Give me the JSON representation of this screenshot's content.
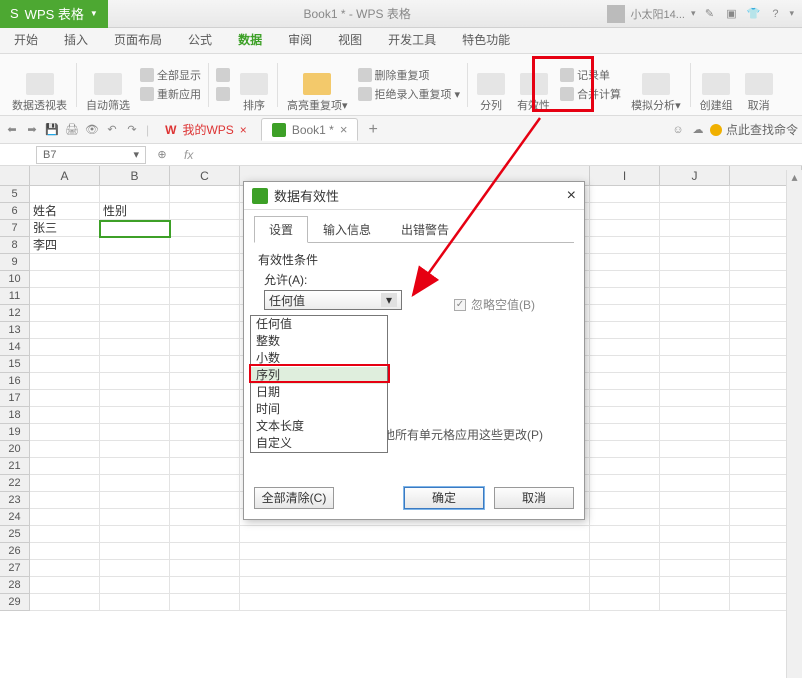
{
  "titlebar": {
    "app_label": "WPS 表格",
    "doc_title": "Book1 * - WPS 表格",
    "user_label": "小太阳14..."
  },
  "menus": {
    "start": "开始",
    "insert": "插入",
    "layout": "页面布局",
    "formula": "公式",
    "data": "数据",
    "review": "审阅",
    "view": "视图",
    "dev": "开发工具",
    "feature": "特色功能"
  },
  "ribbon": {
    "pivot": "数据透视表",
    "autofilter": "自动筛选",
    "showall": "全部显示",
    "reapply": "重新应用",
    "sort": "排序",
    "highlight": "高亮重复项",
    "removedup": "删除重复项",
    "rejectdup": "拒绝录入重复项",
    "split": "分列",
    "validity": "有效性",
    "record": "记录单",
    "consolidate": "合并计算",
    "whatif": "模拟分析",
    "creategroup": "创建组",
    "ungroup": "取消"
  },
  "doctabs": {
    "mywps": "我的WPS",
    "book": "Book1 *",
    "searchcmd": "点此查找命令"
  },
  "namebox": {
    "ref": "B7"
  },
  "cells": {
    "A6": "姓名",
    "B6": "性别",
    "A7": "张三",
    "A8": "李四"
  },
  "cols": [
    "A",
    "B",
    "C",
    "",
    "",
    "",
    "I",
    "J"
  ],
  "dialog": {
    "title": "数据有效性",
    "tabs": {
      "settings": "设置",
      "input": "输入信息",
      "error": "出错警告"
    },
    "cond_label": "有效性条件",
    "allow_label": "允许(A):",
    "combo_value": "任何值",
    "options": [
      "任何值",
      "整数",
      "小数",
      "序列",
      "日期",
      "时间",
      "文本长度",
      "自定义"
    ],
    "ignore_blank": "忽略空值(B)",
    "apply_all": "对所有同样设置的其他所有单元格应用这些更改(P)",
    "clear": "全部清除(C)",
    "ok": "确定",
    "cancel": "取消"
  }
}
